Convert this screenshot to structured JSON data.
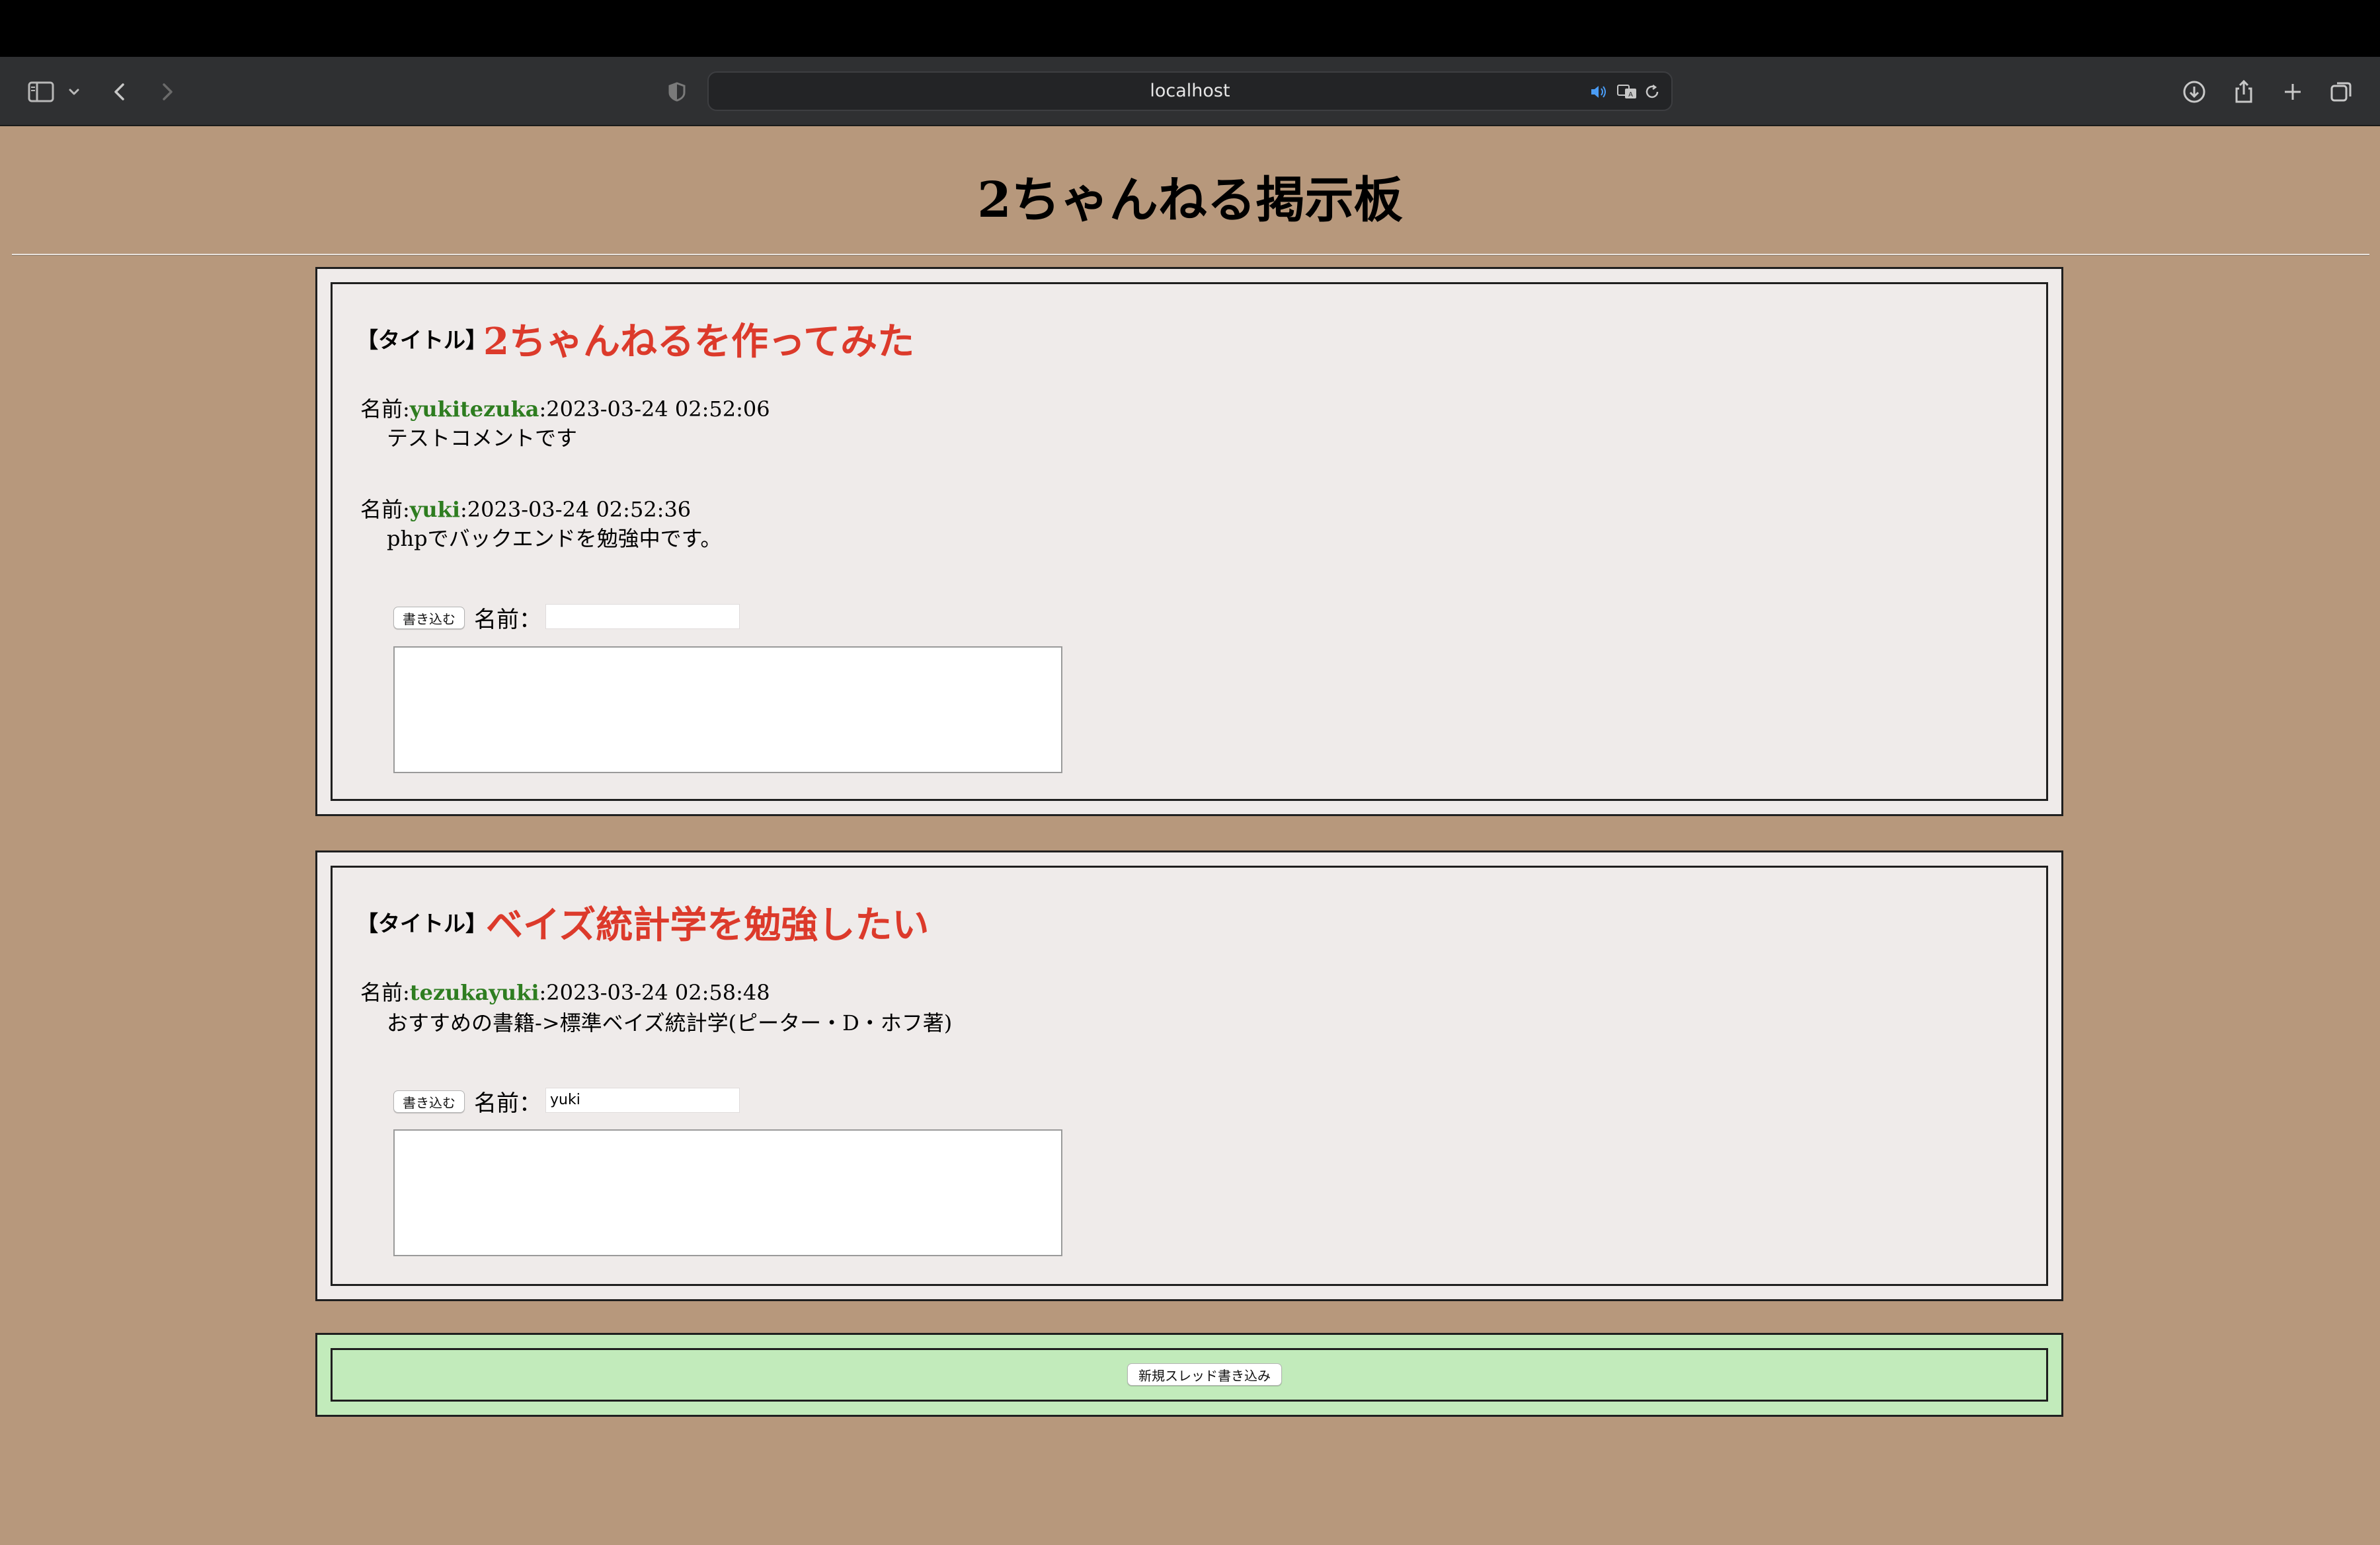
{
  "browser": {
    "url": "localhost",
    "colors": {
      "toolbar": "#2f3032",
      "address_bar": "#232426"
    }
  },
  "page": {
    "title": "2ちゃんねる掲示板",
    "colors": {
      "background": "#b7987c",
      "thread_bg": "#efebea",
      "title_red": "#dc3a2b",
      "name_green": "#2e7d20",
      "new_thread_bg": "#c2ebbb"
    }
  },
  "threads": [
    {
      "label": "【タイトル】",
      "title": "2ちゃんねるを作ってみた",
      "posts": [
        {
          "prefix": "名前:",
          "name": "yukitezuka",
          "datetime": ":2023-03-24 02:52:06",
          "body": "テストコメントです"
        },
        {
          "prefix": "名前:",
          "name": "yuki",
          "datetime": ":2023-03-24 02:52:36",
          "body": "phpでバックエンドを勉強中です。"
        }
      ],
      "form": {
        "button_label": "書き込む",
        "name_label": "名前：",
        "name_value": "",
        "comment_value": ""
      }
    },
    {
      "label": "【タイトル】",
      "title": "ベイズ統計学を勉強したい",
      "posts": [
        {
          "prefix": "名前:",
          "name": "tezukayuki",
          "datetime": ":2023-03-24 02:58:48",
          "body": "おすすめの書籍->標準ベイズ統計学(ピーター・D・ホフ著)"
        }
      ],
      "form": {
        "button_label": "書き込む",
        "name_label": "名前：",
        "name_value": "yuki",
        "comment_value": ""
      }
    }
  ],
  "new_thread": {
    "button_label": "新規スレッド書き込み"
  }
}
